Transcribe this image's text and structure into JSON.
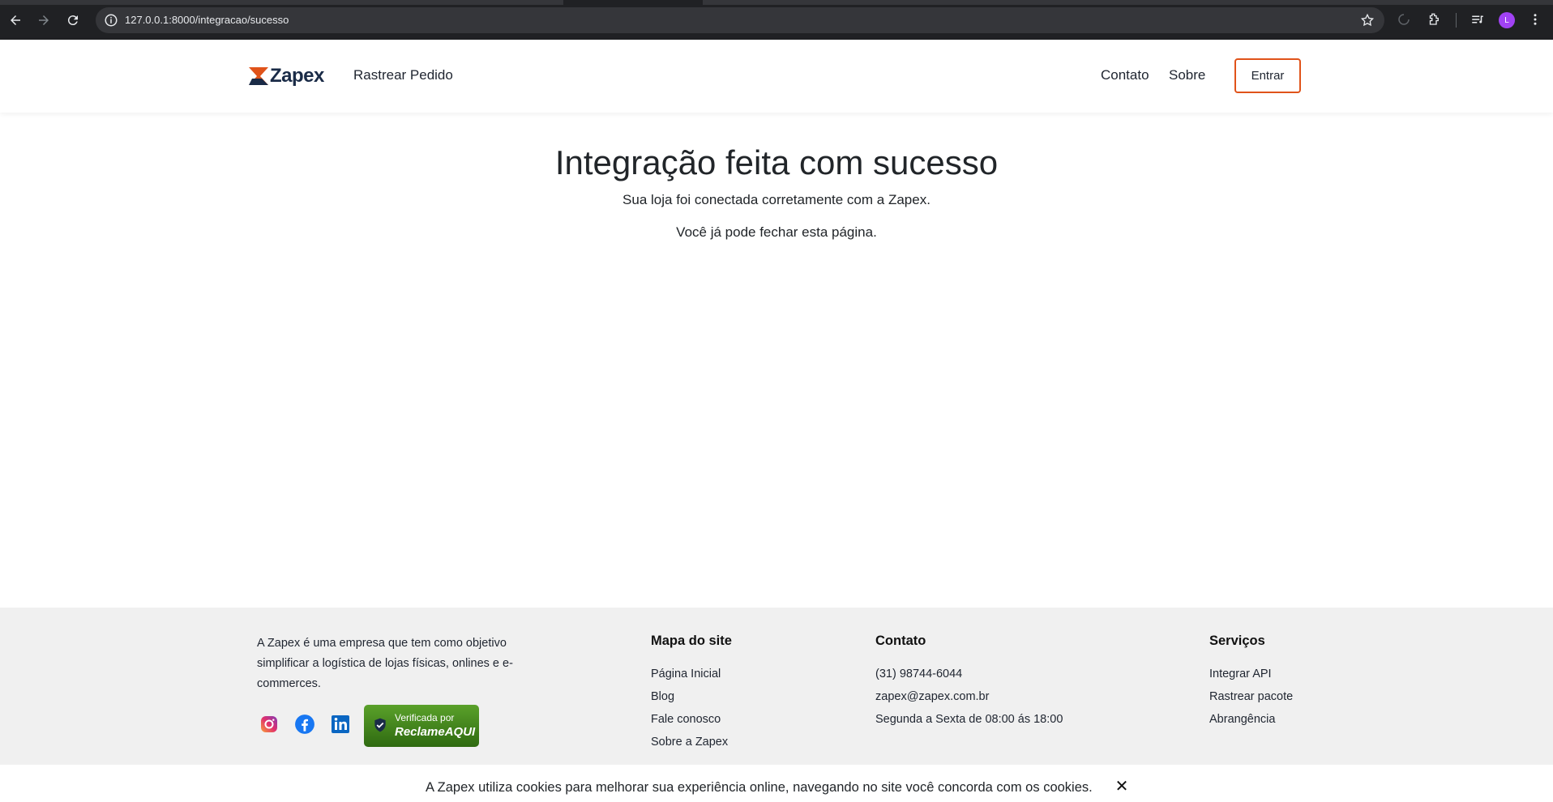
{
  "browser": {
    "url": "127.0.0.1:8000/integracao/sucesso",
    "profile_initial": "L"
  },
  "header": {
    "brand": "Zapex",
    "nav_track": "Rastrear Pedido",
    "nav_contact": "Contato",
    "nav_about": "Sobre",
    "login_label": "Entrar",
    "accent_color": "#e0531a",
    "brand_color": "#1a2b47"
  },
  "main": {
    "title": "Integração feita com sucesso",
    "subtitle": "Sua loja foi conectada corretamente com a Zapex.",
    "note": "Você já pode fechar esta página."
  },
  "footer": {
    "about": "A Zapex é uma empresa que tem como objetivo simplificar a logística de lojas físicas, onlines e e-commerces.",
    "badge": {
      "line1": "Verificada por",
      "line2": "ReclameAQUI"
    },
    "sitemap": {
      "title": "Mapa do site",
      "items": [
        "Página Inicial",
        "Blog",
        "Fale conosco",
        "Sobre a Zapex"
      ]
    },
    "contact": {
      "title": "Contato",
      "items": [
        "(31) 98744-6044",
        "zapex@zapex.com.br",
        "Segunda a Sexta de 08:00 ás 18:00"
      ]
    },
    "services": {
      "title": "Serviços",
      "items": [
        "Integrar API",
        "Rastrear pacote",
        "Abrangência"
      ]
    }
  },
  "cookie": {
    "text": "A Zapex utiliza cookies para melhorar sua experiência online, navegando no site você concorda com os cookies.",
    "close": "✕"
  }
}
